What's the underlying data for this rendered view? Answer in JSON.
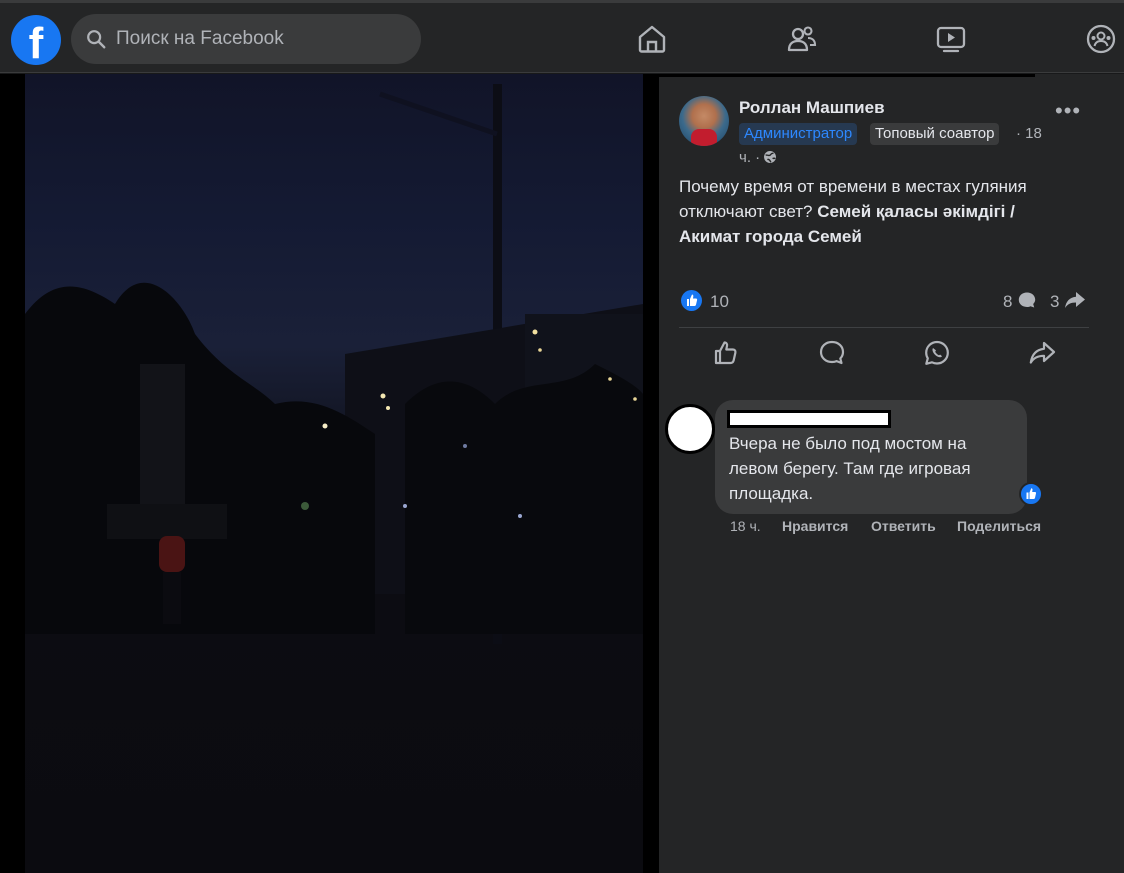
{
  "topbar": {
    "search_placeholder": "Поиск на Facebook",
    "logo_letter": "f"
  },
  "post": {
    "author": "Роллан Машпиев",
    "badge_admin": "Администратор",
    "badge_top": "Топовый соавтор",
    "time_line1": "· 18",
    "time_line2": "ч. ·",
    "text_plain": "Почему время от времени в местах гуляния отключают свет? ",
    "text_bold": "Семей қаласы әкімдігі / Акимат города Семей",
    "likes": "10",
    "comments": "8",
    "shares": "3"
  },
  "comment": {
    "text": "Вчера не было под мостом на левом берегу. Там где игровая площадка.",
    "time": "18 ч.",
    "like_label": "Нравится",
    "reply_label": "Ответить",
    "share_label": "Поделиться"
  },
  "colors": {
    "accent": "#1877f2",
    "panel_bg": "#242526",
    "page_bg": "#18191a"
  }
}
